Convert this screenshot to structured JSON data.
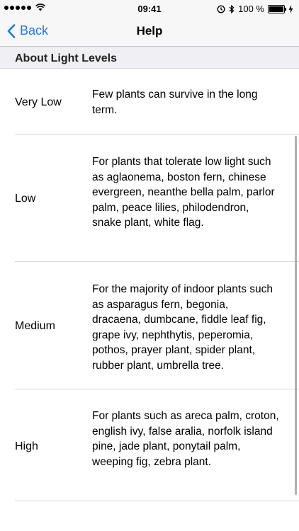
{
  "status_bar": {
    "time": "09:41",
    "battery_percent": "100 %",
    "battery_level": 1.0,
    "icons": [
      "signal-dots-icon",
      "wifi-icon",
      "alarm-icon",
      "bluetooth-icon",
      "battery-icon",
      "charging-icon"
    ]
  },
  "nav": {
    "back_label": "Back",
    "title": "Help"
  },
  "section": {
    "header": "About Light Levels"
  },
  "rows": [
    {
      "level": "Very Low",
      "description": "Few plants can survive in the long term."
    },
    {
      "level": "Low",
      "description": "For plants that tolerate low light such as aglaonema, boston fern, chinese evergreen, neanthe bella palm, parlor palm, peace lilies, philodendron, snake plant, white flag."
    },
    {
      "level": "Medium",
      "description": "For the majority of indoor plants such as asparagus fern, begonia, dracaena, dumbcane, fiddle leaf fig, grape ivy, nephthytis, peperomia, pothos, prayer plant, spider plant, rubber plant, umbrella tree."
    },
    {
      "level": "High",
      "description": "For plants such as areca palm, croton, english ivy, false aralia, norfolk island pine, jade plant, ponytail palm, weeping fig, zebra plant."
    }
  ],
  "colors": {
    "accent": "#1f77f2",
    "bar_background": "#f7f7f7",
    "section_background": "#efeff4"
  }
}
